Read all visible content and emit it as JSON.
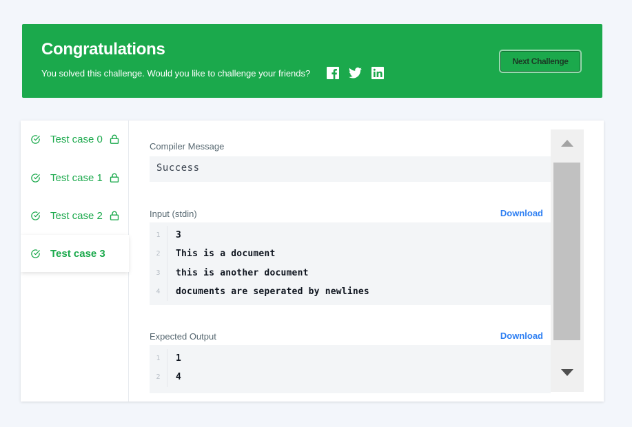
{
  "banner": {
    "title": "Congratulations",
    "subtitle": "You solved this challenge. Would you like to challenge your friends?",
    "social_icons": [
      "facebook-icon",
      "twitter-icon",
      "linkedin-icon"
    ],
    "next_button": "Next Challenge",
    "color": "#1ba94c"
  },
  "tabs": [
    {
      "label": "Test case 0",
      "locked": true,
      "passed": true
    },
    {
      "label": "Test case 1",
      "locked": true,
      "passed": true
    },
    {
      "label": "Test case 2",
      "locked": true,
      "passed": true
    },
    {
      "label": "Test case 3",
      "locked": false,
      "passed": true,
      "active": true
    }
  ],
  "compiler": {
    "label": "Compiler Message",
    "message": "Success"
  },
  "input": {
    "label": "Input (stdin)",
    "download": "Download",
    "lines": [
      {
        "n": "1",
        "text": "3"
      },
      {
        "n": "2",
        "text": "This is a document"
      },
      {
        "n": "3",
        "text": "this is another document"
      },
      {
        "n": "4",
        "text": "documents are seperated by newlines"
      }
    ]
  },
  "expected": {
    "label": "Expected Output",
    "download": "Download",
    "lines": [
      {
        "n": "1",
        "text": "1"
      },
      {
        "n": "2",
        "text": "4"
      }
    ]
  },
  "colors": {
    "success": "#1ba94c",
    "link": "#2e7ff2"
  }
}
